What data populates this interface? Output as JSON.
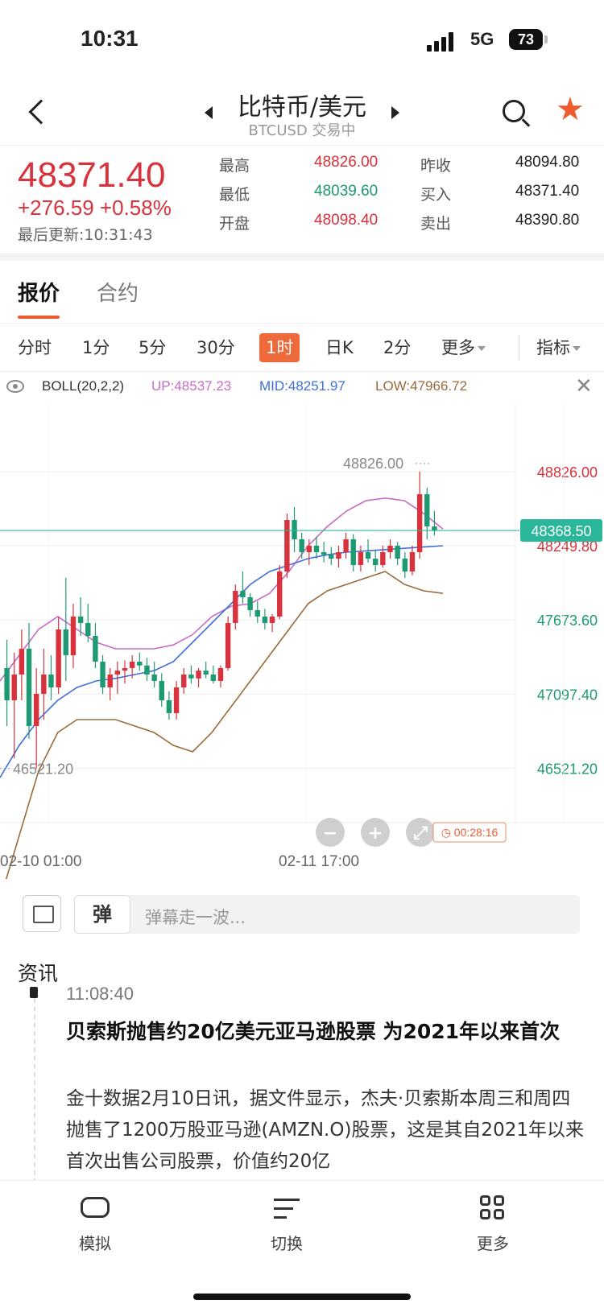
{
  "status": {
    "time": "10:31",
    "network": "5G",
    "battery": "73"
  },
  "nav": {
    "title": "比特币/美元",
    "subtitle": "BTCUSD 交易中"
  },
  "quote": {
    "price": "48371.40",
    "change": "+276.59  +0.58%",
    "updated": "最后更新:10:31:43",
    "high_label": "最高",
    "high": "48826.00",
    "low_label": "最低",
    "low": "48039.60",
    "open_label": "开盘",
    "open": "48098.40",
    "prev_close_label": "昨收",
    "prev_close": "48094.80",
    "bid_label": "买入",
    "bid": "48371.40",
    "ask_label": "卖出",
    "ask": "48390.80"
  },
  "tabs": [
    "报价",
    "合约"
  ],
  "periods": [
    "分时",
    "1分",
    "5分",
    "30分",
    "1时",
    "日K",
    "2分",
    "更多",
    "指标"
  ],
  "active_period": "1时",
  "indicator": {
    "name": "BOLL(20,2,2)",
    "up": "UP:48537.23",
    "mid": "MID:48251.97",
    "low": "LOW:47966.72"
  },
  "colors": {
    "up": "#d8323c",
    "down": "#1e9a73",
    "accent": "#ef5b2f",
    "boll_up": "#c86bc8",
    "boll_mid": "#3d6fd8",
    "boll_low": "#9a6a3a",
    "last_line": "#2bb89a"
  },
  "chart_data": {
    "type": "candlestick",
    "x_labels": [
      "02-10 01:00",
      "02-11 17:00"
    ],
    "y_ticks": [
      48826.0,
      48249.8,
      47673.6,
      47097.4,
      46521.2
    ],
    "y_tick_labels": [
      "48826.00",
      "48249.80",
      "47673.60",
      "47097.40",
      "46521.20"
    ],
    "ylim": [
      46100,
      49300
    ],
    "last_price": "48368.50",
    "max_marker": "48826.00",
    "min_marker": "46521.20",
    "countdown": "00:28:16",
    "candles": [
      [
        47300,
        47520,
        46850,
        47050
      ],
      [
        47050,
        47420,
        46600,
        47250
      ],
      [
        47250,
        47600,
        47050,
        47450
      ],
      [
        47450,
        47650,
        46750,
        46850
      ],
      [
        46850,
        47300,
        46521,
        47100
      ],
      [
        47100,
        47450,
        46900,
        47250
      ],
      [
        47250,
        47400,
        47050,
        47150
      ],
      [
        47150,
        47700,
        47100,
        47600
      ],
      [
        47600,
        48000,
        47200,
        47400
      ],
      [
        47400,
        47800,
        47300,
        47700
      ],
      [
        47700,
        47850,
        47550,
        47650
      ],
      [
        47650,
        47800,
        47500,
        47550
      ],
      [
        47550,
        47650,
        47300,
        47350
      ],
      [
        47350,
        47400,
        47100,
        47150
      ],
      [
        47150,
        47300,
        47050,
        47250
      ],
      [
        47250,
        47350,
        47100,
        47280
      ],
      [
        47280,
        47360,
        47180,
        47300
      ],
      [
        47300,
        47400,
        47220,
        47350
      ],
      [
        47350,
        47420,
        47280,
        47320
      ],
      [
        47320,
        47380,
        47200,
        47250
      ],
      [
        47250,
        47350,
        47150,
        47200
      ],
      [
        47200,
        47260,
        47000,
        47050
      ],
      [
        47050,
        47120,
        46900,
        46950
      ],
      [
        46950,
        47200,
        46900,
        47150
      ],
      [
        47150,
        47300,
        47100,
        47250
      ],
      [
        47250,
        47320,
        47180,
        47220
      ],
      [
        47220,
        47300,
        47150,
        47280
      ],
      [
        47280,
        47350,
        47220,
        47250
      ],
      [
        47250,
        47320,
        47180,
        47200
      ],
      [
        47200,
        47320,
        47150,
        47300
      ],
      [
        47300,
        47700,
        47280,
        47650
      ],
      [
        47650,
        47950,
        47600,
        47900
      ],
      [
        47900,
        48050,
        47800,
        47850
      ],
      [
        47850,
        47880,
        47700,
        47750
      ],
      [
        47750,
        47820,
        47650,
        47700
      ],
      [
        47700,
        47760,
        47600,
        47650
      ],
      [
        47650,
        47720,
        47580,
        47700
      ],
      [
        47700,
        48100,
        47680,
        48050
      ],
      [
        48050,
        48500,
        48000,
        48450
      ],
      [
        48450,
        48550,
        48200,
        48300
      ],
      [
        48300,
        48350,
        48150,
        48200
      ],
      [
        48200,
        48300,
        48100,
        48250
      ],
      [
        48250,
        48320,
        48150,
        48200
      ],
      [
        48200,
        48280,
        48120,
        48180
      ],
      [
        48180,
        48240,
        48100,
        48150
      ],
      [
        48150,
        48250,
        48080,
        48200
      ],
      [
        48200,
        48350,
        48150,
        48300
      ],
      [
        48300,
        48340,
        48050,
        48100
      ],
      [
        48100,
        48250,
        48050,
        48200
      ],
      [
        48200,
        48300,
        48120,
        48150
      ],
      [
        48150,
        48220,
        48050,
        48100
      ],
      [
        48100,
        48250,
        48080,
        48200
      ],
      [
        48200,
        48300,
        48150,
        48250
      ],
      [
        48250,
        48280,
        48100,
        48150
      ],
      [
        48150,
        48200,
        48000,
        48050
      ],
      [
        48050,
        48250,
        48020,
        48200
      ],
      [
        48200,
        48826,
        48150,
        48650
      ],
      [
        48650,
        48700,
        48300,
        48400
      ],
      [
        48400,
        48520,
        48330,
        48368
      ]
    ],
    "boll_up": [
      47200,
      47400,
      47600,
      47700,
      47600,
      47500,
      47450,
      47450,
      47450,
      47480,
      47560,
      47700,
      47780,
      47800,
      47880,
      48050,
      48250,
      48400,
      48520,
      48600,
      48620,
      48600,
      48500,
      48380
    ],
    "boll_mid": [
      46450,
      46700,
      46900,
      47050,
      47150,
      47200,
      47220,
      47250,
      47280,
      47350,
      47500,
      47650,
      47800,
      47950,
      48050,
      48100,
      48150,
      48180,
      48200,
      48210,
      48220,
      48230,
      48240,
      48250
    ],
    "boll_low": [
      45500,
      46000,
      46500,
      46800,
      46900,
      46900,
      46900,
      46850,
      46800,
      46700,
      46650,
      46800,
      47000,
      47200,
      47400,
      47600,
      47800,
      47900,
      47950,
      48000,
      48050,
      47950,
      47900,
      47880
    ]
  },
  "danmu": {
    "badge": "弹",
    "placeholder": "弹幕走一波..."
  },
  "news": {
    "header": "资讯",
    "time": "11:08:40",
    "title": "贝索斯抛售约20亿美元亚马逊股票 为2021年以来首次",
    "body": "金十数据2月10日讯，据文件显示，杰夫·贝索斯本周三和周四抛售了1200万股亚马逊(AMZN.O)股票，这是其自2021年以来首次出售公司股票，价值约20亿"
  },
  "bottom_nav": [
    "模拟",
    "切换",
    "更多"
  ]
}
